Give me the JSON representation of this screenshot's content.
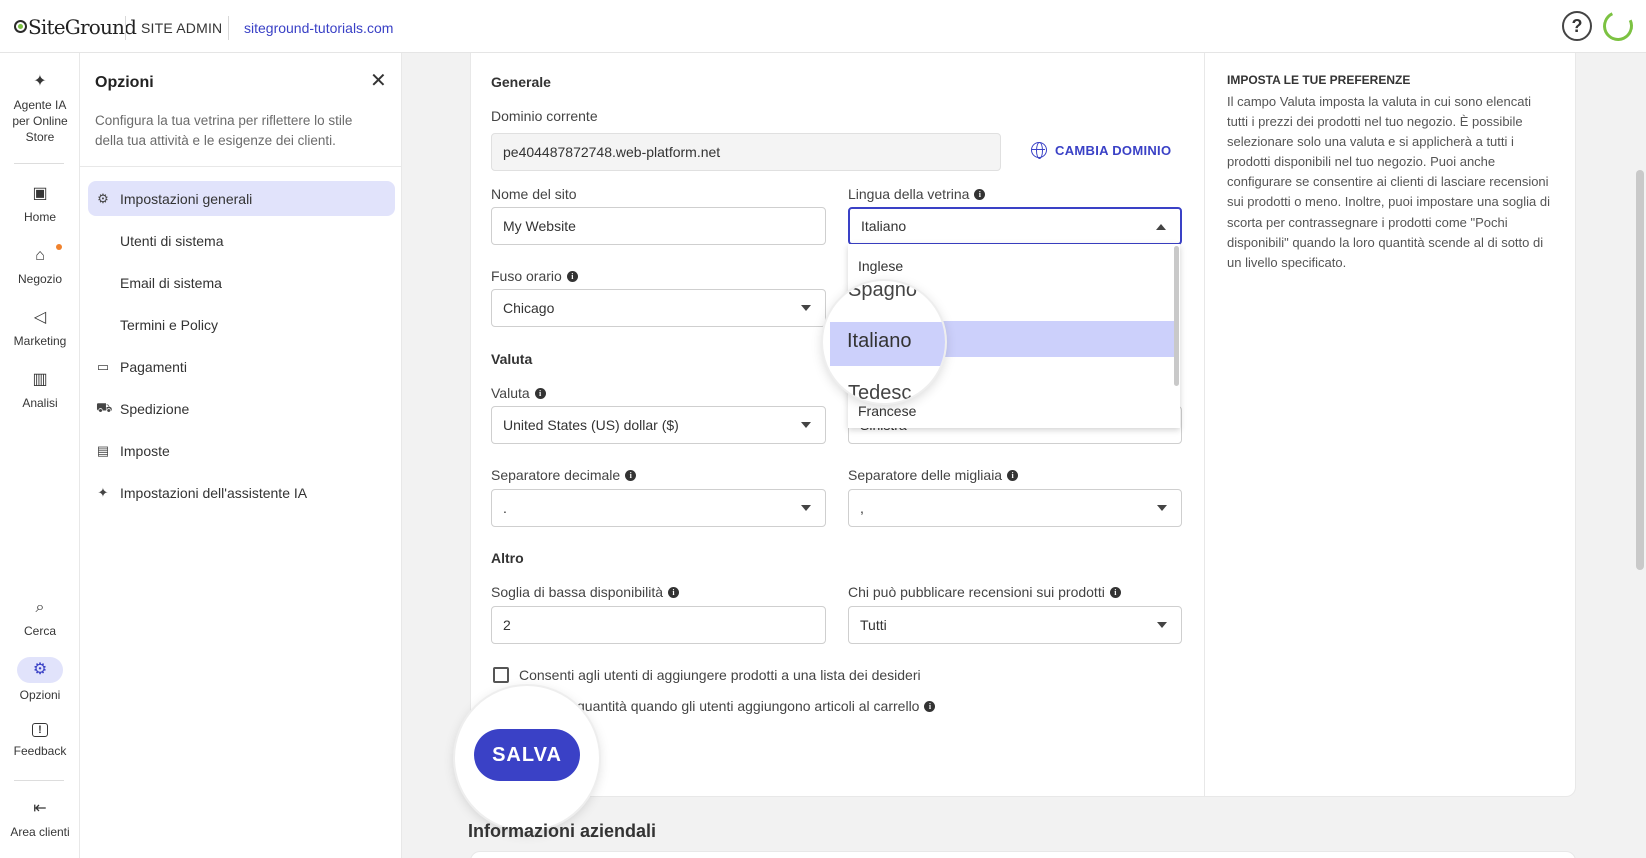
{
  "topbar": {
    "brand": "SiteGround",
    "section": "SITE ADMIN",
    "domain": "siteground-tutorials.com",
    "help_icon": "?"
  },
  "nav": {
    "items": [
      {
        "label": "Agente IA per Online Store",
        "icon": "sparkle-icon"
      },
      {
        "label": "Home",
        "icon": "home-icon"
      },
      {
        "label": "Negozio",
        "icon": "store-icon"
      },
      {
        "label": "Marketing",
        "icon": "megaphone-icon"
      },
      {
        "label": "Analisi",
        "icon": "chart-icon"
      },
      {
        "label": "Cerca",
        "icon": "search-icon"
      },
      {
        "label": "Opzioni",
        "icon": "gear-icon"
      },
      {
        "label": "Feedback",
        "icon": "feedback-icon"
      },
      {
        "label": "Area clienti",
        "icon": "logout-icon"
      }
    ],
    "glyphs": {
      "sparkle": "✦",
      "home": "▣",
      "store": "⌂",
      "megaphone": "◁",
      "chart": "▥",
      "search": "⌕",
      "gear": "⚙",
      "feedback": "!",
      "logout": "⇤"
    }
  },
  "panel": {
    "title": "Opzioni",
    "description": "Configura la tua vetrina per riflettere lo stile della tua attività e le esigenze dei clienti.",
    "close": "✕",
    "menu": [
      {
        "label": "Impostazioni generali",
        "icon": "⚙"
      },
      {
        "label": "Utenti di sistema"
      },
      {
        "label": "Email di sistema"
      },
      {
        "label": "Termini e Policy"
      },
      {
        "label": "Pagamenti",
        "icon": "▭"
      },
      {
        "label": "Spedizione",
        "icon": "⛟"
      },
      {
        "label": "Imposte",
        "icon": "▤"
      },
      {
        "label": "Impostazioni dell'assistente IA",
        "icon": "✦"
      }
    ]
  },
  "form": {
    "section_general": "Generale",
    "current_domain_label": "Dominio corrente",
    "current_domain_value": "pe404487872748.web-platform.net",
    "change_domain": "CAMBIA DOMINIO",
    "site_name_label": "Nome del sito",
    "site_name_value": "My Website",
    "language_label": "Lingua della vetrina",
    "language_value": "Italiano",
    "timezone_label": "Fuso orario",
    "timezone_value": "Chicago",
    "section_currency": "Valuta",
    "currency_label": "Valuta",
    "currency_value": "United States (US) dollar ($)",
    "currency_position_value": "Sinistra",
    "decimal_sep_label": "Separatore decimale",
    "decimal_sep_value": ".",
    "thousand_sep_label": "Separatore delle migliaia",
    "thousand_sep_value": ",",
    "section_other": "Altro",
    "low_stock_label": "Soglia di bassa disponibilità",
    "low_stock_value": "2",
    "reviews_label": "Chi può pubblicare recensioni sui prodotti",
    "reviews_value": "Tutti",
    "wishlist_text": "Consenti agli utenti di aggiungere prodotti a una lista dei desideri",
    "qty_text": "quantità quando gli utenti aggiungono articoli al carrello",
    "save": "SALVA"
  },
  "language_dropdown": {
    "options": [
      "Inglese",
      "Spagnolo",
      "Italiano",
      "Tedesco",
      "Francese"
    ],
    "partial_above": "Spagno",
    "partial_below": "Tedesc",
    "selected": "Italiano"
  },
  "aside": {
    "title": "IMPOSTA LE TUE PREFERENZE",
    "text": "Il campo Valuta imposta la valuta in cui sono elencati tutti i prezzi dei prodotti nel tuo negozio. È possibile selezionare solo una valuta e si applicherà a tutti i prodotti disponibili nel tuo negozio. Puoi anche configurare se consentire ai clienti di lasciare recensioni sui prodotti o meno. Inoltre, puoi impostare una soglia di scorta per contrassegnare i prodotti come \"Pochi disponibili\" quando la loro quantità scende al di sotto di un livello specificato."
  },
  "next_section": "Informazioni aziendali",
  "colors": {
    "accent": "#3a41c6",
    "accent_light": "#e1e3fb",
    "brand_green": "#7cc242"
  }
}
